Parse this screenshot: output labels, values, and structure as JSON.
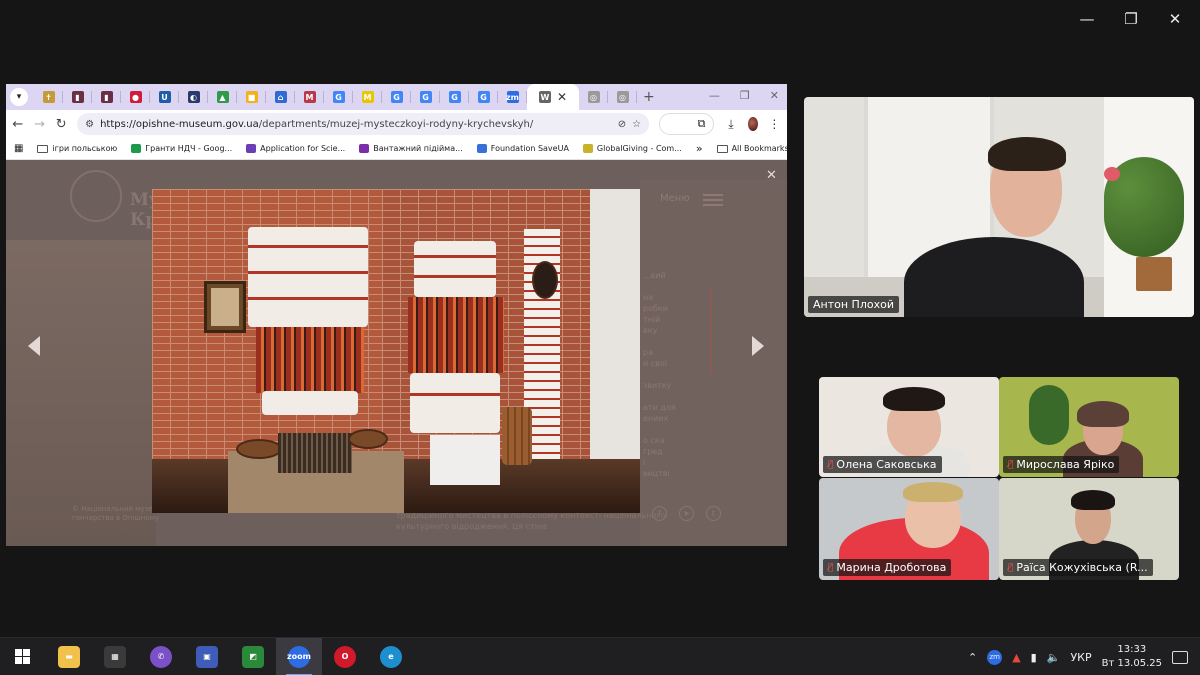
{
  "zoom_window": {
    "minimize": "—",
    "restore": "❐",
    "close": "✕"
  },
  "browser": {
    "tabs": [
      {
        "icon": "tab-icon-tree",
        "color": "#c59a3a",
        "glyph": "✝"
      },
      {
        "icon": "tab-icon-book",
        "color": "#6b2f45",
        "glyph": "▮"
      },
      {
        "icon": "tab-icon-book",
        "color": "#6b2f45",
        "glyph": "▮"
      },
      {
        "icon": "tab-icon-japan",
        "color": "#d01c3a",
        "glyph": "●"
      },
      {
        "icon": "tab-icon-u",
        "color": "#1f5da8",
        "glyph": "U"
      },
      {
        "icon": "tab-icon-halfcircle",
        "color": "#2a3a6a",
        "glyph": "◐"
      },
      {
        "icon": "tab-icon-drive",
        "color": "#2f9a4a",
        "glyph": "▲"
      },
      {
        "icon": "tab-icon-slides",
        "color": "#f2b21c",
        "glyph": "■"
      },
      {
        "icon": "tab-icon-flag-ua",
        "color": "#2f6bd2",
        "glyph": "⌂"
      },
      {
        "icon": "tab-icon-m-circle",
        "color": "#b83a4a",
        "glyph": "M"
      },
      {
        "icon": "tab-icon-google",
        "color": "#4285f4",
        "glyph": "G"
      },
      {
        "icon": "tab-icon-m-yellow",
        "color": "#e9c600",
        "glyph": "M"
      },
      {
        "icon": "tab-icon-google",
        "color": "#4285f4",
        "glyph": "G"
      },
      {
        "icon": "tab-icon-google",
        "color": "#4285f4",
        "glyph": "G"
      },
      {
        "icon": "tab-icon-google",
        "color": "#4285f4",
        "glyph": "G"
      },
      {
        "icon": "tab-icon-google",
        "color": "#4285f4",
        "glyph": "G"
      },
      {
        "icon": "tab-icon-zoom",
        "color": "#2d6ce3",
        "glyph": "zm"
      },
      {
        "icon": "tab-icon-wikipedia",
        "color": "#666666",
        "glyph": "W"
      },
      {
        "icon": "tab-icon-museum",
        "color": "#9a9a9a",
        "glyph": "◎"
      },
      {
        "icon": "tab-icon-museum",
        "color": "#9a9a9a",
        "glyph": "◎"
      }
    ],
    "url_host": "https://opishne-museum.gov.ua",
    "url_path": "/departments/muzej-mysteczkoyi-rodyny-krychevskyh/",
    "bookmarks": [
      {
        "label": "ігри польською",
        "kind": "folder"
      },
      {
        "label": "Гранти НДЧ - Goog...",
        "kind": "site",
        "color": "#1a9a4a"
      },
      {
        "label": "Application for Scie...",
        "kind": "site",
        "color": "#6a3fb5"
      },
      {
        "label": "Вантажний підійма...",
        "kind": "site",
        "color": "#7a2fa8"
      },
      {
        "label": "Foundation SaveUA",
        "kind": "site",
        "color": "#3a6fd8"
      },
      {
        "label": "GlobalGiving - Com...",
        "kind": "site",
        "color": "#c7b22a"
      }
    ],
    "bookmarks_more": "»",
    "all_bookmarks": "All Bookmarks",
    "page": {
      "site_title_line1": "Му",
      "site_title_line2": "Кр",
      "menu_label": "Меню",
      "side_text": "...вий\n\nна\nробки\nтній\nвку\n\nра\nи свої\n\nзвитку\n\nати для\nениих\n\nо ска\nгред\nі\nвецтві",
      "below_text": "традиційного мистецтва в поліссному контексті національного культурного відродження. Ця стіна",
      "copyright": "© Національний музей\nгончарства в Опішному"
    }
  },
  "participants": [
    {
      "id": "main",
      "name": "Антон Плохой",
      "muted": false
    },
    {
      "id": "olena",
      "name": "Олена Саковська",
      "muted": true
    },
    {
      "id": "myro",
      "name": "Мирослава Ярiко",
      "muted": true
    },
    {
      "id": "maryna",
      "name": "Марина Дроботова",
      "muted": true
    },
    {
      "id": "raisa",
      "name": "Раїса Кожухівська (R...",
      "muted": true
    }
  ],
  "taskbar": {
    "apps": [
      {
        "name": "file-explorer",
        "color": "#f2c14b",
        "glyph": "▬"
      },
      {
        "name": "calculator",
        "color": "#3a3a3a",
        "glyph": "▦"
      },
      {
        "name": "viber",
        "color": "#7b51c8",
        "glyph": "✆"
      },
      {
        "name": "save-app",
        "color": "#3e5cb8",
        "glyph": "▣"
      },
      {
        "name": "office-app",
        "color": "#2a8a3a",
        "glyph": "◩"
      },
      {
        "name": "zoom",
        "color": "#2d6ce3",
        "glyph": "zoom"
      },
      {
        "name": "opera",
        "color": "#d0192a",
        "glyph": "O"
      },
      {
        "name": "edge",
        "color": "#1d8fcf",
        "glyph": "e"
      }
    ],
    "active_app": "zoom",
    "language": "УКР",
    "time": "13:33",
    "date": "Вт 13.05.25"
  }
}
